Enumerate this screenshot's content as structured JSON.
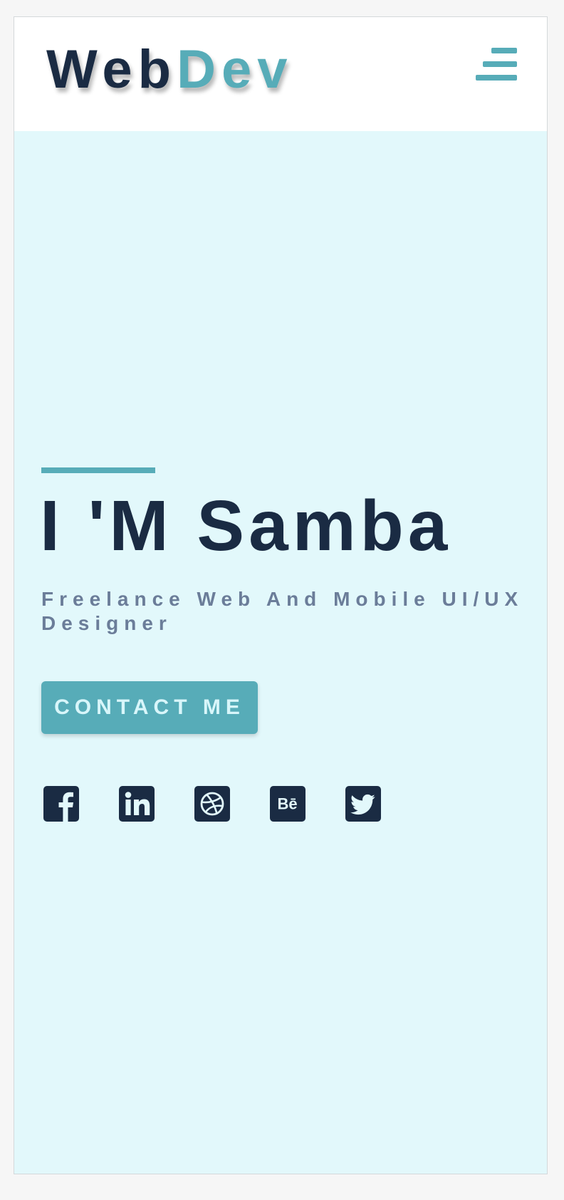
{
  "brand": {
    "part1": "Web",
    "part2": "Dev"
  },
  "nav": {
    "menu_icon": "hamburger-menu-icon"
  },
  "hero": {
    "headline": "I 'M Samba",
    "subtitle": "Freelance Web And Mobile UI/UX Designer",
    "cta_label": "CONTACT ME"
  },
  "social": [
    {
      "icon": "facebook-icon"
    },
    {
      "icon": "linkedin-icon"
    },
    {
      "icon": "dribbble-icon"
    },
    {
      "icon": "behance-icon"
    },
    {
      "icon": "twitter-icon"
    }
  ],
  "colors": {
    "navy": "#1a2b43",
    "accent": "#57acb8",
    "hero_background": "#e2f8fb",
    "subtitle": "#6b7d99",
    "button_text": "#d8f6fa"
  }
}
